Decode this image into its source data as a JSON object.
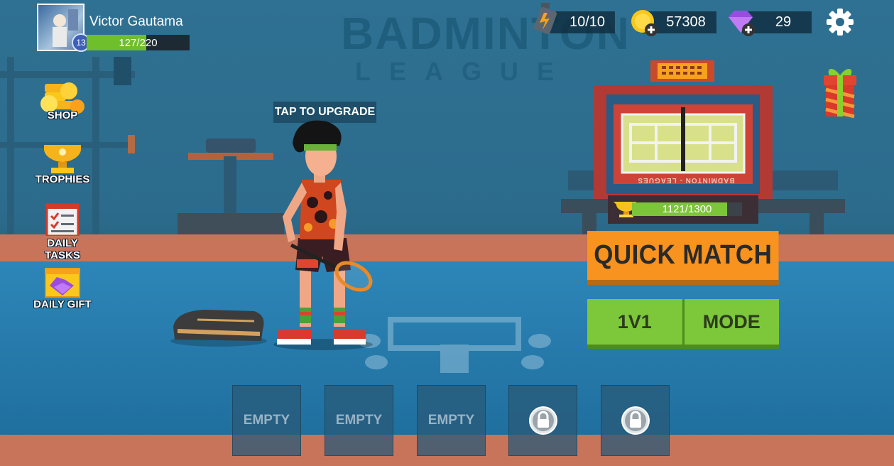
{
  "player": {
    "name": "Victor Gautama",
    "level": "13",
    "xp_text": "127/220",
    "xp_progress": 0.577
  },
  "resources": {
    "energy": "10/10",
    "coins": "57308",
    "gems": "29"
  },
  "background": {
    "title": "BADMINTON",
    "subtitle": "LEAGUE"
  },
  "menu": {
    "shop": "SHOP",
    "trophies": "TROPHIES",
    "daily_tasks": "DAILY TASKS",
    "daily_gift": "DAILY GIFT"
  },
  "upgrade_hint": "TAP TO UPGRADE",
  "league": {
    "board_text": "BADMINTON - LEAGUES",
    "progress_text": "1121/1300",
    "progress": 0.862
  },
  "buttons": {
    "quick_match": "QUICK MATCH",
    "mode_left": "1V1",
    "mode_right": "MODE"
  },
  "slots": [
    {
      "label": "EMPTY",
      "locked": false
    },
    {
      "label": "EMPTY",
      "locked": false
    },
    {
      "label": "EMPTY",
      "locked": false
    },
    {
      "label": "",
      "locked": true
    },
    {
      "label": "",
      "locked": true
    }
  ],
  "colors": {
    "accent_orange": "#f7931e",
    "accent_green": "#7cc73a",
    "xp_green": "#6fbf2c",
    "gem_purple": "#9b4be0",
    "coin_yellow": "#f9c81a"
  }
}
